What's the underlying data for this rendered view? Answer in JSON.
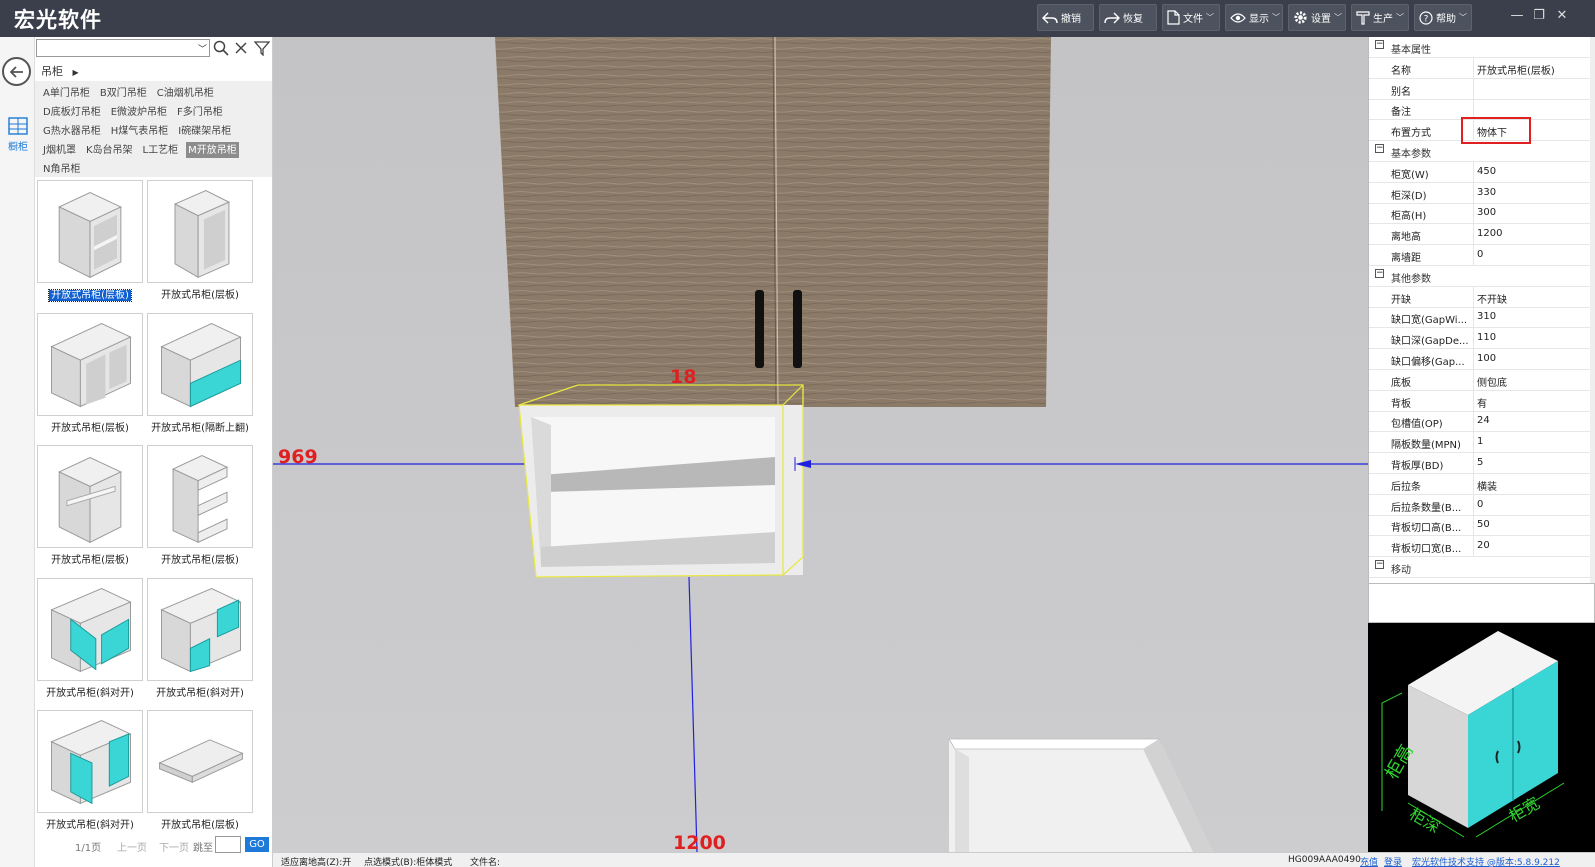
{
  "app": {
    "title": "宏光软件"
  },
  "toolbar": [
    {
      "label": "撤销",
      "icon": "undo-icon"
    },
    {
      "label": "恢复",
      "icon": "redo-icon"
    },
    {
      "label": "文件",
      "icon": "file-icon"
    },
    {
      "label": "显示",
      "icon": "eye-icon"
    },
    {
      "label": "设置",
      "icon": "gear-icon"
    },
    {
      "label": "生产",
      "icon": "hammer-icon"
    },
    {
      "label": "帮助",
      "icon": "help-icon"
    }
  ],
  "sidenav": {
    "cabinet_label": "橱柜"
  },
  "library": {
    "search_value": "",
    "breadcrumb": "吊柜",
    "categories": [
      "A单门吊柜",
      "B双门吊柜",
      "C油烟机吊柜",
      "D底板灯吊柜",
      "E微波炉吊柜",
      "F多门吊柜",
      "G热水器吊柜",
      "H煤气表吊柜",
      "I碗碟架吊柜",
      "J烟机罩",
      "K岛台吊架",
      "L工艺柜",
      "M开放吊柜",
      "N角吊柜"
    ],
    "active_category": "M开放吊柜",
    "items": [
      {
        "label": "开放式吊柜(层板)",
        "selected": true
      },
      {
        "label": "开放式吊柜(层板)"
      },
      {
        "label": "开放式吊柜(层板)"
      },
      {
        "label": "开放式吊柜(隔断上翻)"
      },
      {
        "label": "开放式吊柜(层板)"
      },
      {
        "label": "开放式吊柜(层板)"
      },
      {
        "label": "开放式吊柜(斜对开)"
      },
      {
        "label": "开放式吊柜(斜对开)"
      },
      {
        "label": "开放式吊柜(斜对开)"
      },
      {
        "label": "开放式吊柜(层板)"
      }
    ],
    "pager": {
      "page": "1/1页",
      "prev": "上一页",
      "next": "下一页",
      "jump": "跳至",
      "go": "GO"
    }
  },
  "viewport": {
    "dim_top": "18",
    "dim_left": "969",
    "dim_bottom": "1200",
    "colors": {
      "wood": "#8a7966",
      "guide": "#2020e0",
      "selection": "#e8e840",
      "dimension": "#e02020"
    }
  },
  "statusbar": {
    "snap": "适应离地高(Z):开",
    "select_mode": "点选模式(B):柜体模式",
    "file_name": "文件名:",
    "code": "HG009AAA0490",
    "recharge": "充值",
    "login": "登录",
    "support": "宏光软件技术支持 @版本:5.8.9.212"
  },
  "properties": {
    "sections": [
      {
        "title": "基本属性",
        "rows": [
          {
            "key": "名称",
            "value": "开放式吊柜(层板)"
          },
          {
            "key": "别名",
            "value": ""
          },
          {
            "key": "备注",
            "value": ""
          },
          {
            "key": "布置方式",
            "value": "物体下",
            "highlight": true
          }
        ]
      },
      {
        "title": "基本参数",
        "rows": [
          {
            "key": "柜宽(W)",
            "value": "450"
          },
          {
            "key": "柜深(D)",
            "value": "330"
          },
          {
            "key": "柜高(H)",
            "value": "300"
          },
          {
            "key": "离地高",
            "value": "1200"
          },
          {
            "key": "离墙距",
            "value": "0"
          }
        ]
      },
      {
        "title": "其他参数",
        "rows": [
          {
            "key": "开缺",
            "value": "不开缺"
          },
          {
            "key": "缺口宽(GapWi...",
            "value": "310"
          },
          {
            "key": "缺口深(GapDe...",
            "value": "110"
          },
          {
            "key": "缺口偏移(Gap...",
            "value": "100"
          },
          {
            "key": "底板",
            "value": "侧包底"
          },
          {
            "key": "背板",
            "value": "有"
          },
          {
            "key": "包槽值(OP)",
            "value": "24"
          },
          {
            "key": "隔板数量(MPN)",
            "value": "1"
          },
          {
            "key": "背板厚(BD)",
            "value": "5"
          },
          {
            "key": "后拉条",
            "value": "横装"
          },
          {
            "key": "后拉条数量(B...",
            "value": "0"
          },
          {
            "key": "背板切口高(B...",
            "value": "50"
          },
          {
            "key": "背板切口宽(B...",
            "value": "20"
          }
        ]
      },
      {
        "title": "移动",
        "rows": []
      }
    ]
  },
  "preview": {
    "label_height": "柜高",
    "label_depth": "柜深",
    "label_width": "柜宽",
    "colors": {
      "door": "#3ad6d6",
      "line": "#2fd62f"
    }
  }
}
